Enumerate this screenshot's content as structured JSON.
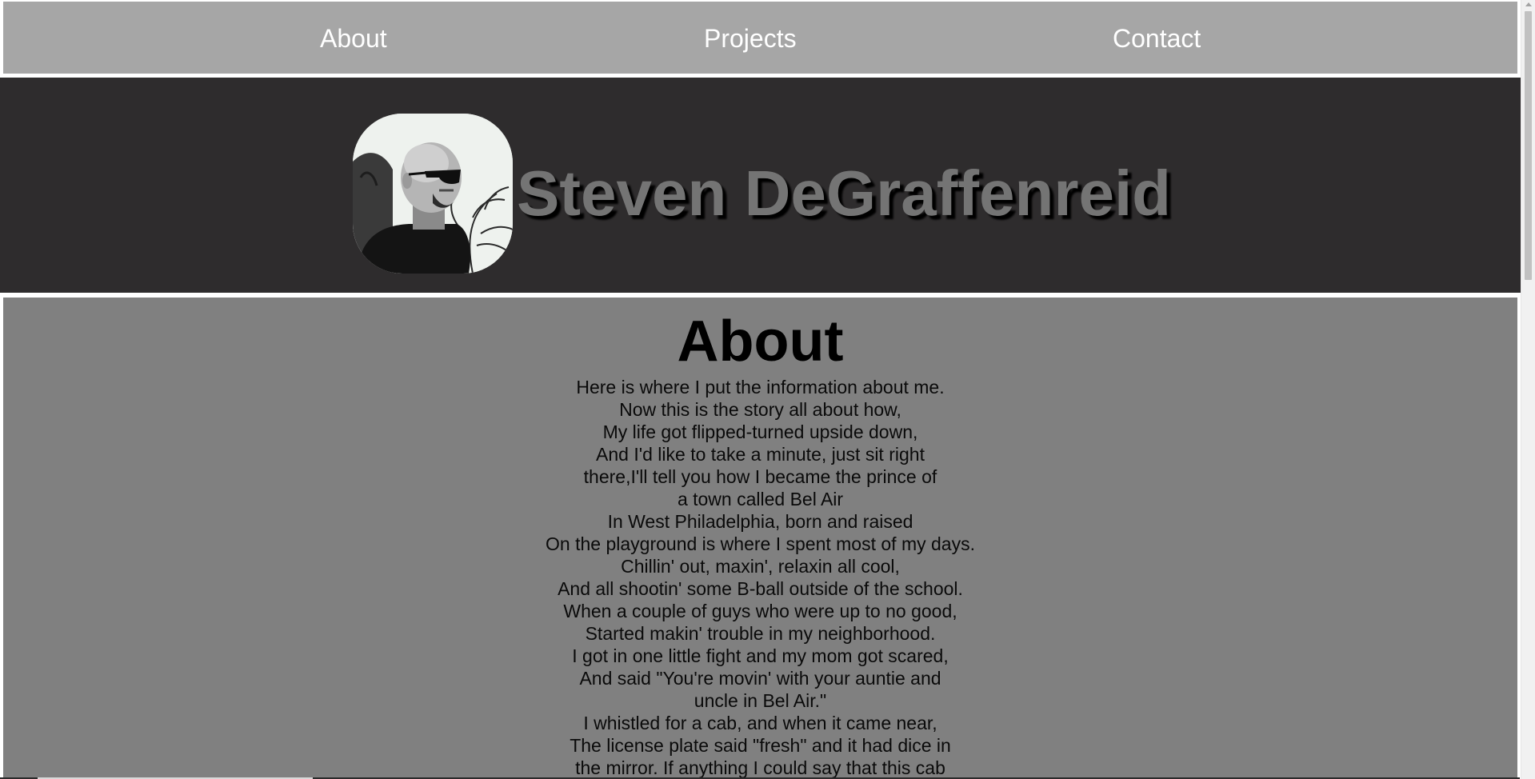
{
  "nav": {
    "about": "About",
    "projects": "Projects",
    "contact": "Contact"
  },
  "header": {
    "name": "Steven DeGraffenreid"
  },
  "about": {
    "title": "About",
    "lines": [
      "Here is where I put the information about me.",
      "Now this is the story all about how,",
      "My life got flipped-turned upside down,",
      "And I'd like to take a minute, just sit right",
      "there,I'll tell you how I became the prince of",
      "a town called Bel Air",
      "In West Philadelphia, born and raised",
      "On the playground is where I spent most of my days.",
      "Chillin' out, maxin', relaxin all cool,",
      "And all shootin' some B-ball outside of the school.",
      "When a couple of guys who were up to no good,",
      "Started makin' trouble in my neighborhood.",
      "I got in one little fight and my mom got scared,",
      "And said \"You're movin' with your auntie and",
      "uncle in Bel Air.\"",
      "I whistled for a cab, and when it came near,",
      "The license plate said \"fresh\" and it had dice in",
      "the mirror. If anything I could say that this cab"
    ]
  },
  "colors": {
    "navbar_bg": "#a6a6a6",
    "header_bg": "#2e2c2d",
    "name_color": "#747474",
    "about_bg": "#808080"
  }
}
